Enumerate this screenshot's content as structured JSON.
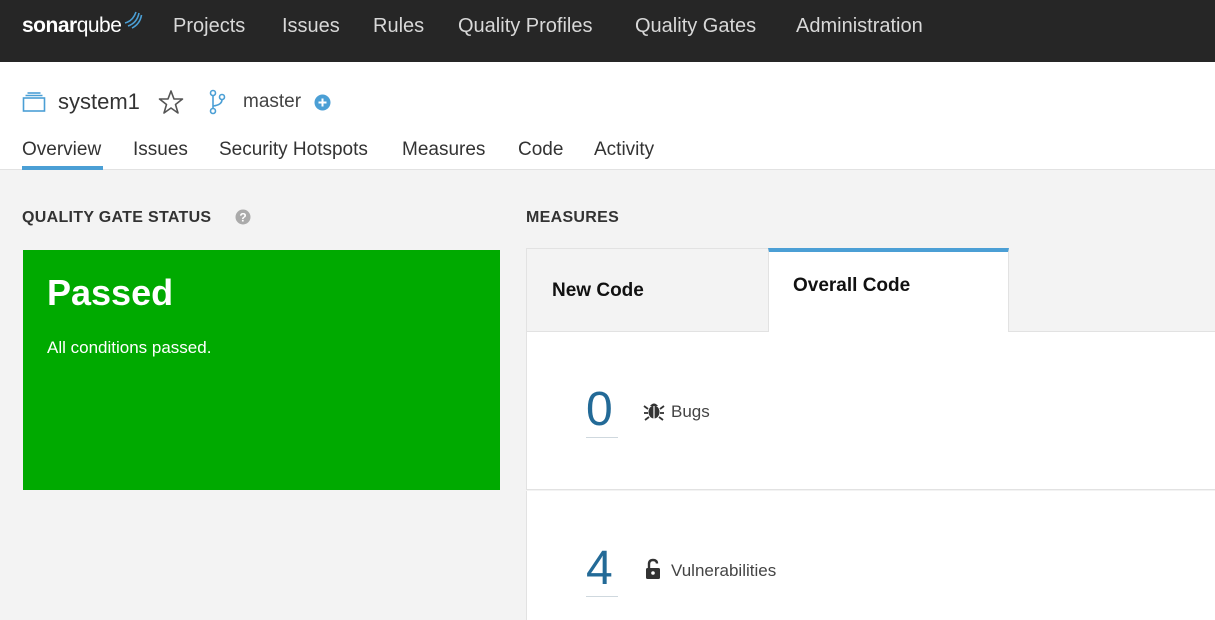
{
  "brand": {
    "name_bold": "sonar",
    "name_light": "qube"
  },
  "topnav": {
    "items": [
      {
        "label": "Projects"
      },
      {
        "label": "Issues"
      },
      {
        "label": "Rules"
      },
      {
        "label": "Quality Profiles"
      },
      {
        "label": "Quality Gates"
      },
      {
        "label": "Administration"
      }
    ]
  },
  "project": {
    "name": "system1",
    "branch": "master"
  },
  "tabs": [
    {
      "label": "Overview",
      "active": true
    },
    {
      "label": "Issues"
    },
    {
      "label": "Security Hotspots"
    },
    {
      "label": "Measures"
    },
    {
      "label": "Code"
    },
    {
      "label": "Activity"
    }
  ],
  "quality_gate": {
    "title": "QUALITY GATE STATUS",
    "status": "Passed",
    "message": "All conditions passed.",
    "color": "#00aa00"
  },
  "measures": {
    "title": "MEASURES",
    "tabs": [
      {
        "label": "New Code"
      },
      {
        "label": "Overall Code",
        "active": true
      }
    ],
    "items": [
      {
        "value": "0",
        "label": "Bugs",
        "icon": "bug-icon"
      },
      {
        "value": "4",
        "label": "Vulnerabilities",
        "icon": "lock-icon"
      }
    ]
  },
  "colors": {
    "navbar": "#262626",
    "accent": "#4b9fd5",
    "metric_value": "#236a97",
    "passed": "#00aa00"
  }
}
